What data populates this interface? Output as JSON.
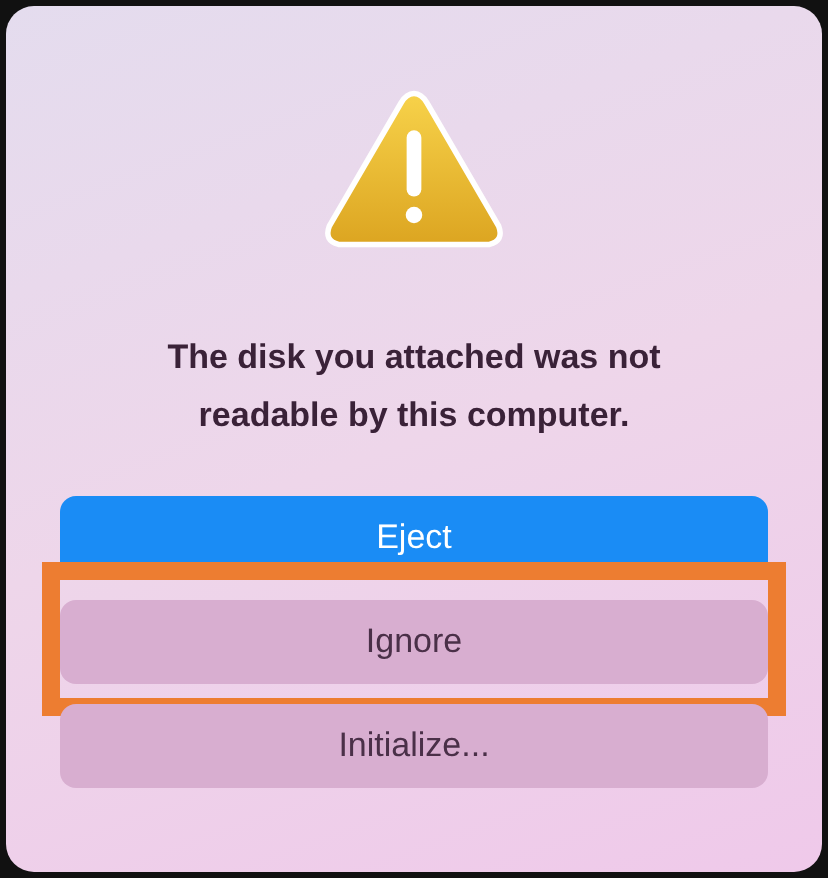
{
  "alert": {
    "message": "The disk you attached was not readable by this computer.",
    "buttons": [
      {
        "label": "Eject",
        "kind": "default",
        "highlighted": false
      },
      {
        "label": "Ignore",
        "kind": "normal",
        "highlighted": true
      },
      {
        "label": "Initialize...",
        "kind": "normal",
        "highlighted": false
      }
    ]
  }
}
